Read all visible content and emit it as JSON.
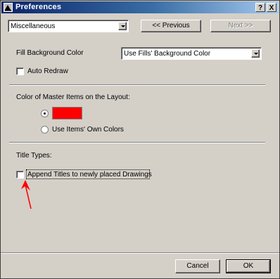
{
  "window": {
    "title": "Preferences",
    "help_label": "?",
    "close_label": "X"
  },
  "toolbar": {
    "category_value": "Miscellaneous",
    "previous_label": "<< Previous",
    "next_label": "Next >>"
  },
  "fill": {
    "label": "Fill Background Color",
    "value": "Use Fills' Background Color"
  },
  "auto_redraw": {
    "label": "Auto Redraw",
    "checked": false
  },
  "master_color": {
    "heading": "Color of Master Items on the Layout:",
    "swatch_color": "#ff0000",
    "own_colors_label": "Use Items' Own Colors"
  },
  "titles": {
    "heading": "Title Types:",
    "append_label": "Append Titles to newly placed Drawings",
    "checked": false
  },
  "annotation": {
    "arrow_color": "#ff0000"
  },
  "buttons": {
    "cancel_label": "Cancel",
    "ok_label": "OK"
  }
}
